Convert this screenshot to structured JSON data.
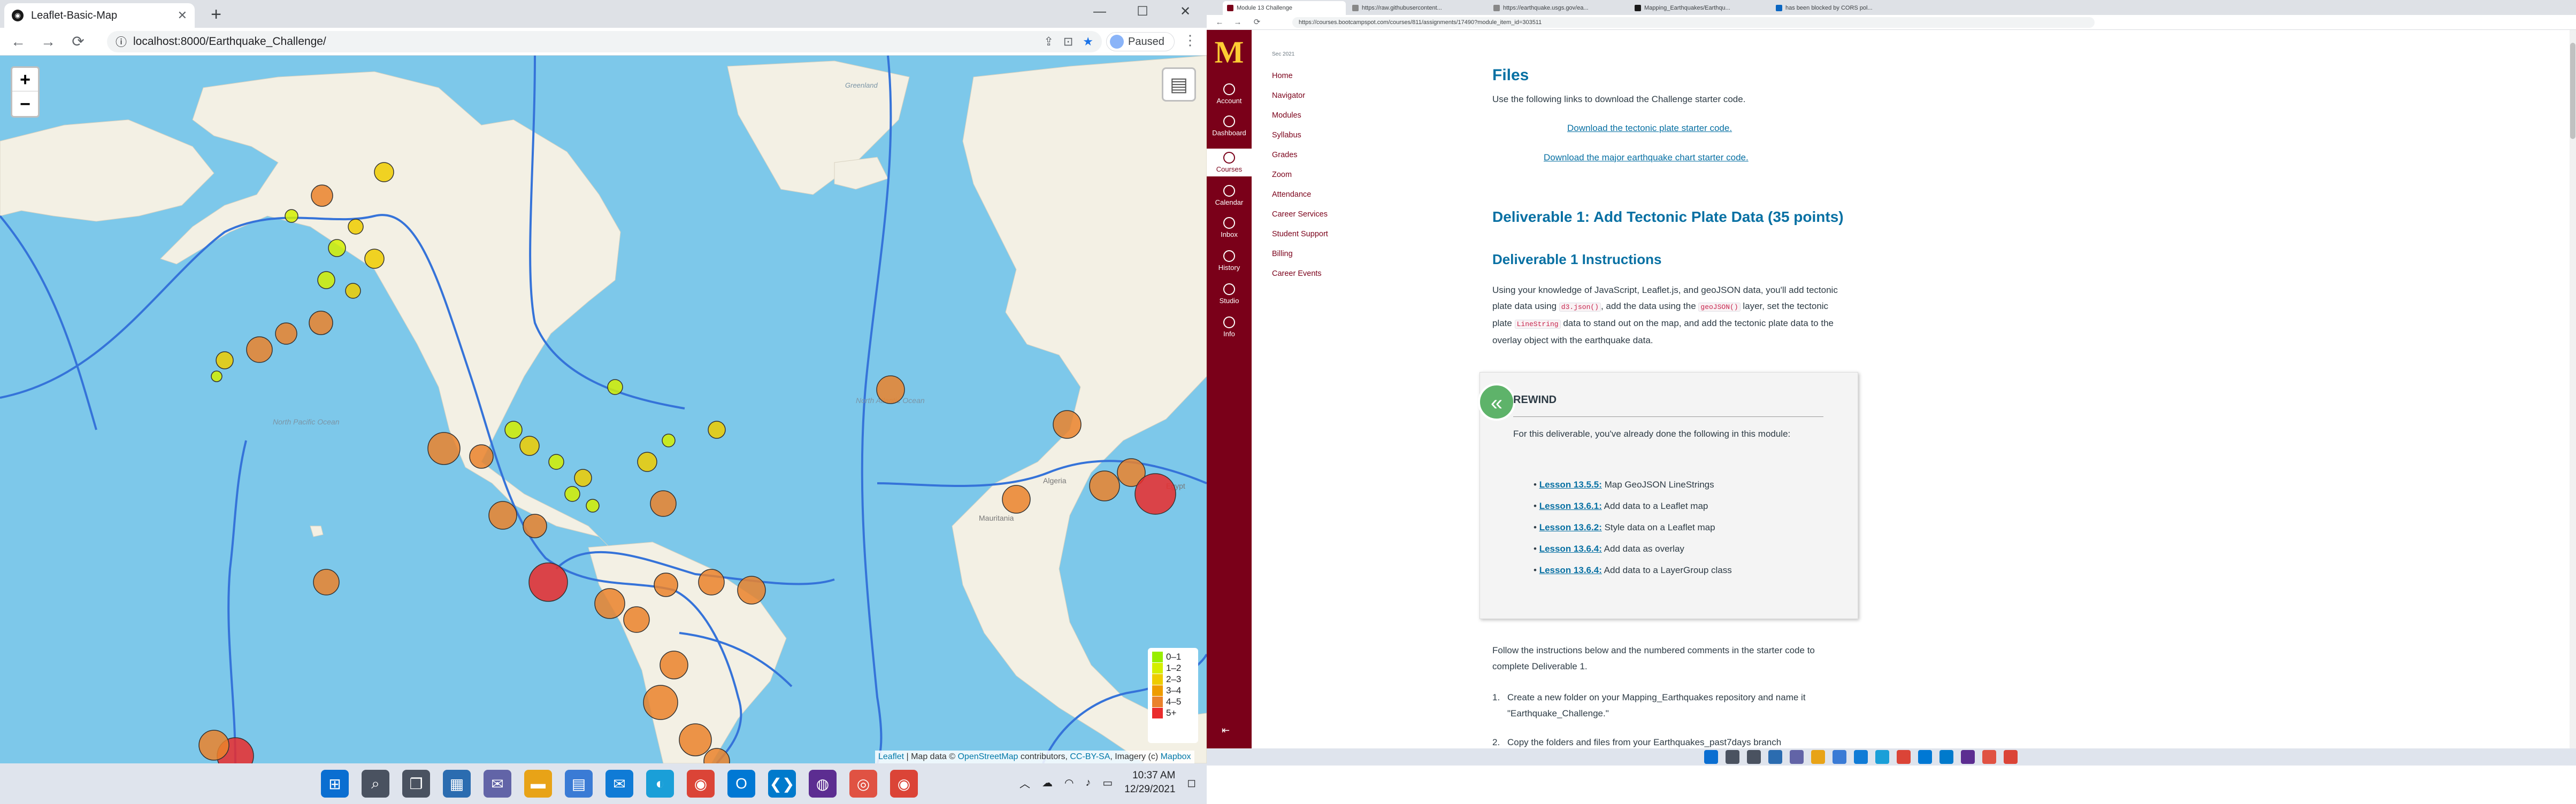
{
  "left_browser": {
    "tab": {
      "title": "Leaflet-Basic-Map",
      "close": "✕"
    },
    "new_tab": "+",
    "window_controls": {
      "minimize": "—",
      "maximize": "☐",
      "close": "✕"
    },
    "toolbar": {
      "back": "←",
      "forward": "→",
      "reload": "⟳",
      "url": "localhost:8000/Earthquake_Challenge/",
      "profile_status": "Paused"
    },
    "map": {
      "zoom_in": "+",
      "zoom_out": "−",
      "legend": [
        {
          "label": "0–1",
          "color": "#98ee00"
        },
        {
          "label": "1–2",
          "color": "#d4ee00"
        },
        {
          "label": "2–3",
          "color": "#eecc00"
        },
        {
          "label": "3–4",
          "color": "#ee9c00"
        },
        {
          "label": "4–5",
          "color": "#ea822c"
        },
        {
          "label": "5+",
          "color": "#ea2c2c"
        }
      ],
      "attribution": {
        "leaflet": "Leaflet",
        "sep1": " | Map data © ",
        "osm": "OpenStreetMap",
        "sep2": " contributors, ",
        "license": "CC-BY-SA",
        "sep3": ", Imagery (c) ",
        "mapbox": "Mapbox"
      },
      "labels": {
        "greenland": "Greenland",
        "north_pacific": "North Pacific Ocean",
        "north_atlantic": "North Atlantic Ocean",
        "algeria": "Algeria",
        "egypt": "Egypt",
        "mauritania": "Mauritania"
      }
    },
    "taskbar": {
      "time": "10:37 AM",
      "date": "12/29/2021"
    }
  },
  "right_browser": {
    "tabs": [
      {
        "title": "Module 13 Challenge"
      },
      {
        "title": "https://raw.githubusercontent..."
      },
      {
        "title": "https://earthquake.usgs.gov/ea..."
      },
      {
        "title": "Mapping_Earthquakes/Earthqu..."
      },
      {
        "title": "has been blocked by CORS pol..."
      }
    ],
    "url": "https://courses.bootcampspot.com/courses/811/assignments/17490?module_item_id=303511",
    "global_nav": [
      {
        "label": "Account"
      },
      {
        "label": "Dashboard"
      },
      {
        "label": "Courses"
      },
      {
        "label": "Calendar"
      },
      {
        "label": "Inbox"
      },
      {
        "label": "History"
      },
      {
        "label": "Studio"
      },
      {
        "label": "Info"
      }
    ],
    "course_term": "Sec 2021",
    "course_nav": [
      "Home",
      "Navigator",
      "Modules",
      "Syllabus",
      "Grades",
      "Zoom",
      "Attendance",
      "Career Services",
      "Student Support",
      "Billing",
      "Career Events"
    ],
    "content": {
      "files_heading": "Files",
      "files_intro": "Use the following links to download the Challenge starter code.",
      "link1": "Download the tectonic plate starter code.",
      "link2": "Download the major earthquake chart starter code.",
      "deliverable_heading": "Deliverable 1: Add Tectonic Plate Data (35 points)",
      "instructions_heading": "Deliverable 1 Instructions",
      "para_parts": {
        "p1": "Using your knowledge of JavaScript, Leaflet.js, and geoJSON data, you'll add tectonic plate data using ",
        "code1": "d3.json()",
        "p2": ", add the data using the ",
        "code2": "geoJSON()",
        "p3": " layer, set the tectonic plate ",
        "code3": "LineString",
        "p4": " data to stand out on the map, and add the tectonic plate data to the overlay object with the earthquake data."
      },
      "rewind": {
        "title": "REWIND",
        "intro": "For this deliverable, you've already done the following in this module:",
        "items": [
          {
            "lesson": "Lesson 13.5.5:",
            "text": "Map GeoJSON LineStrings"
          },
          {
            "lesson": "Lesson 13.6.1:",
            "text": "Add data to a Leaflet map"
          },
          {
            "lesson": "Lesson 13.6.2:",
            "text": "Style data on a Leaflet map"
          },
          {
            "lesson": "Lesson 13.6.4:",
            "text": "Add data as overlay"
          },
          {
            "lesson": "Lesson 13.6.4:",
            "text": "Add data to a LayerGroup class"
          }
        ]
      },
      "follow": "Follow the instructions below and the numbered comments in the starter code to complete Deliverable 1.",
      "step1": "Create a new folder on your Mapping_Earthquakes repository and name it \"Earthquake_Challenge.\"",
      "step2": "Copy the folders and files from your Earthquakes_past7days branch"
    }
  }
}
